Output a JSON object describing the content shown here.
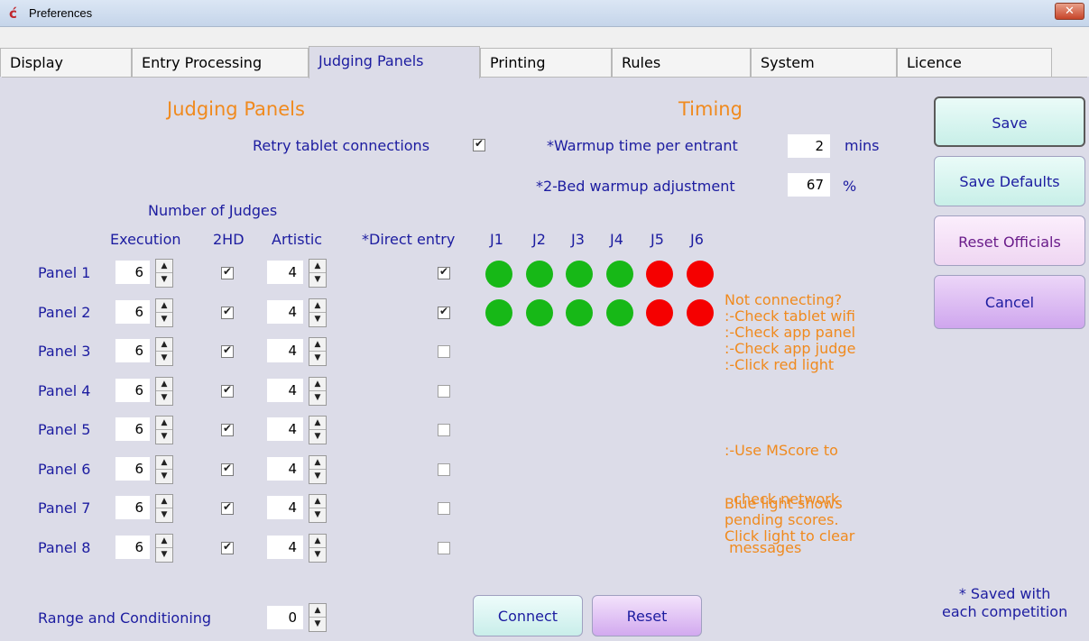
{
  "window": {
    "title": "Preferences",
    "close_glyph": "✕"
  },
  "tabs": [
    "Display",
    "Entry Processing",
    "Judging Panels",
    "Printing",
    "Rules",
    "System",
    "Licence"
  ],
  "active_tab": "Judging Panels",
  "judging": {
    "heading": "Judging Panels",
    "retry_label": "Retry tablet connections",
    "retry_checked": true,
    "number_of_judges_label": "Number of Judges",
    "col_execution": "Execution",
    "col_2hd": "2HD",
    "col_artistic": "Artistic",
    "col_direct_entry": "*Direct entry",
    "judge_headers": [
      "J1",
      "J2",
      "J3",
      "J4",
      "J5",
      "J6"
    ],
    "panels": [
      {
        "label": "Panel 1",
        "execution": "6",
        "two_hd": true,
        "artistic": "4",
        "direct_entry": true
      },
      {
        "label": "Panel 2",
        "execution": "6",
        "two_hd": true,
        "artistic": "4",
        "direct_entry": true
      },
      {
        "label": "Panel 3",
        "execution": "6",
        "two_hd": true,
        "artistic": "4",
        "direct_entry": false
      },
      {
        "label": "Panel 4",
        "execution": "6",
        "two_hd": true,
        "artistic": "4",
        "direct_entry": false
      },
      {
        "label": "Panel 5",
        "execution": "6",
        "two_hd": true,
        "artistic": "4",
        "direct_entry": false
      },
      {
        "label": "Panel 6",
        "execution": "6",
        "two_hd": true,
        "artistic": "4",
        "direct_entry": false
      },
      {
        "label": "Panel 7",
        "execution": "6",
        "two_hd": true,
        "artistic": "4",
        "direct_entry": false
      },
      {
        "label": "Panel 8",
        "execution": "6",
        "two_hd": true,
        "artistic": "4",
        "direct_entry": false
      }
    ],
    "lights": [
      [
        "green",
        "green",
        "green",
        "green",
        "red",
        "red"
      ],
      [
        "green",
        "green",
        "green",
        "green",
        "red",
        "red"
      ]
    ],
    "range_label": "Range and Conditioning",
    "range_value": "0"
  },
  "timing": {
    "heading": "Timing",
    "warmup_label": "*Warmup time per entrant",
    "warmup_value": "2",
    "warmup_unit": "mins",
    "bed_label": "*2-Bed warmup adjustment",
    "bed_value": "67",
    "bed_unit": "%"
  },
  "help_notes": {
    "connecting": [
      "Not connecting?",
      ":-Check tablet wifi",
      ":-Check app panel",
      ":-Check app judge",
      ":-Click red light"
    ],
    "mscore": [
      ":-Use MScore to",
      "  check network",
      " messages"
    ],
    "blue_light": [
      "Blue light shows",
      "pending scores.",
      "Click light to clear"
    ]
  },
  "buttons": {
    "save": "Save",
    "save_defaults": "Save Defaults",
    "reset_officials": "Reset Officials",
    "cancel": "Cancel",
    "connect": "Connect",
    "reset": "Reset"
  },
  "footnote": [
    "*  Saved with",
    "each competition"
  ],
  "colors": {
    "green": "#17b817",
    "red": "#f50000",
    "label_blue": "#1c1ca0",
    "accent_orange": "#f08a1e"
  }
}
